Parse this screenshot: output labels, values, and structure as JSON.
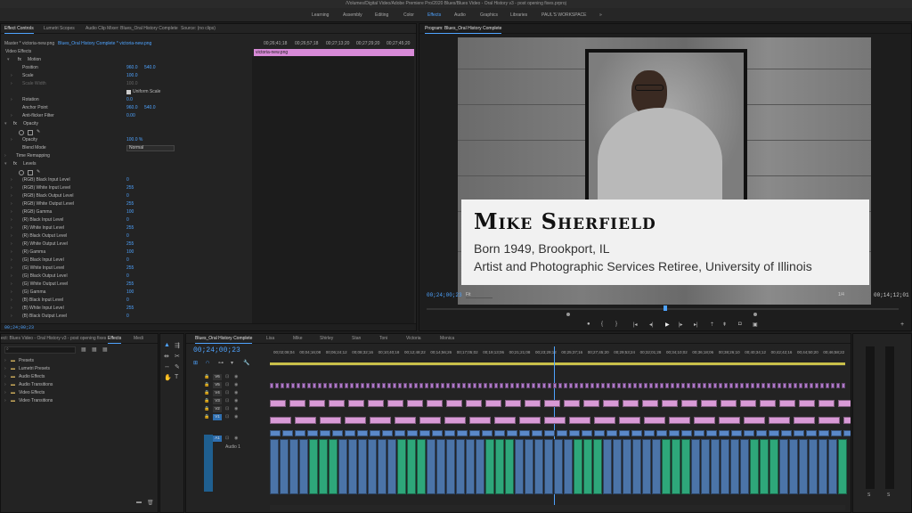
{
  "window_title": "/Volumes/Digital Video/Adobe Premiere Pro/2020 Blues/Blues Video - Oral History v3 - post opening fixes.prproj",
  "workspaces": [
    {
      "label": "Learning",
      "active": false
    },
    {
      "label": "Assembly",
      "active": false
    },
    {
      "label": "Editing",
      "active": false
    },
    {
      "label": "Color",
      "active": false
    },
    {
      "label": "Effects",
      "active": true
    },
    {
      "label": "Audio",
      "active": false
    },
    {
      "label": "Graphics",
      "active": false
    },
    {
      "label": "Libraries",
      "active": false
    },
    {
      "label": "PAUL'S WORKSPACE",
      "active": false
    }
  ],
  "workspace_more": "»",
  "source_tabs": [
    "Effect Controls",
    "Lumetri Scopes",
    "Audio Clip Mixer: Blues_Oral History Complete",
    "Source: (no clips)"
  ],
  "effect_controls": {
    "master_label": "Master * victoria-new.png",
    "sequence_label": "Blues_Oral History Complete * victoria-new.png",
    "timeline_times": [
      "00;26;41;18",
      "00;26;57;18",
      "00;27;13;20",
      "00;27;29;20",
      "00;27;45;20"
    ],
    "clip_name": "victoria-new.png",
    "section_video": "Video Effects",
    "motion": "Motion",
    "position_label": "Position",
    "position_x": "960.0",
    "position_y": "540.0",
    "scale_label": "Scale",
    "scale_val": "100.0",
    "scale_width_label": "Scale Width",
    "scale_width_val": "100.0",
    "uniform_scale": "Uniform Scale",
    "rotation_label": "Rotation",
    "rotation_val": "0.0",
    "anchor_label": "Anchor Point",
    "anchor_x": "960.0",
    "anchor_y": "540.0",
    "antiflicker_label": "Anti-flicker Filter",
    "antiflicker_val": "0.00",
    "opacity_section": "Opacity",
    "opacity_label": "Opacity",
    "opacity_val": "100.0 %",
    "blend_label": "Blend Mode",
    "blend_val": "Normal",
    "time_remap": "Time Remapping",
    "levels": "Levels",
    "level_rows": [
      {
        "label": "(RGB) Black Input Level",
        "val": "0"
      },
      {
        "label": "(RGB) White Input Level",
        "val": "255"
      },
      {
        "label": "(RGB) Black Output Level",
        "val": "0"
      },
      {
        "label": "(RGB) White Output Level",
        "val": "255"
      },
      {
        "label": "(RGB) Gamma",
        "val": "100"
      },
      {
        "label": "(R) Black Input Level",
        "val": "0"
      },
      {
        "label": "(R) White Input Level",
        "val": "255"
      },
      {
        "label": "(R) Black Output Level",
        "val": "0"
      },
      {
        "label": "(R) White Output Level",
        "val": "255"
      },
      {
        "label": "(R) Gamma",
        "val": "100"
      },
      {
        "label": "(G) Black Input Level",
        "val": "0"
      },
      {
        "label": "(G) White Input Level",
        "val": "255"
      },
      {
        "label": "(G) Black Output Level",
        "val": "0"
      },
      {
        "label": "(G) White Output Level",
        "val": "255"
      },
      {
        "label": "(G) Gamma",
        "val": "100"
      },
      {
        "label": "(B) Black Input Level",
        "val": "0"
      },
      {
        "label": "(B) White Input Level",
        "val": "255"
      },
      {
        "label": "(B) Black Output Level",
        "val": "0"
      }
    ],
    "current_time": "00;24;00;23"
  },
  "program": {
    "tab": "Program: Blues_Oral History Complete",
    "name": "Mike Sherfield",
    "line1": "Born 1949, Brookport, IL",
    "line2": "Artist and Photographic Services Retiree, University of Illinois",
    "timecode": "00;24;00;23",
    "fit": "Fit",
    "ratio": "1/4",
    "duration": "00;14;12;01"
  },
  "project": {
    "tabs": [
      "ect: Blues Video - Oral History v3 - post opening fixes",
      "Effects",
      "Medi"
    ],
    "items": [
      "Presets",
      "Lumetri Presets",
      "Audio Effects",
      "Audio Transitions",
      "Video Effects",
      "Video Transitions"
    ]
  },
  "timeline": {
    "tabs": [
      "Blues_Oral History Complete",
      "Lisa",
      "Mike",
      "Shirley",
      "Stan",
      "Toni",
      "Victoria",
      "Monica"
    ],
    "timecode": "00;24;00;23",
    "ruler": [
      "00;02;08;04",
      "00;04;16;08",
      "00;06;24;12",
      "00;08;32;16",
      "00;10;40;18",
      "00;12;48;22",
      "00;14;56;26",
      "00;17;05;02",
      "00;19;13;06",
      "00;21;21;08",
      "00;23;29;12",
      "00;25;37;16",
      "00;27;45;20",
      "00;29;53;24",
      "00;32;01;28",
      "00;34;10;02",
      "00;36;18;06",
      "00;38;26;10",
      "00;40;34;12",
      "00;42;42;16",
      "00;44;50;20",
      "00;46;58;22"
    ],
    "tracks": [
      "V6",
      "V5",
      "V4",
      "V3",
      "V2",
      "V1",
      "A1"
    ],
    "audio_label": "Audio 1"
  },
  "meter": {
    "labels": [
      "S",
      "S"
    ]
  }
}
